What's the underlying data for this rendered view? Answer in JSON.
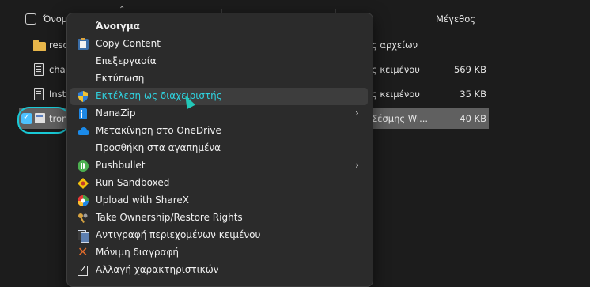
{
  "header": {
    "name_col": "Όνομ",
    "size_col": "Μέγεθος"
  },
  "files": [
    {
      "name": "reso",
      "type_partial": "ς αρχείων",
      "size": "",
      "icon": "folder-icon",
      "selected": false
    },
    {
      "name": "chan",
      "type_partial": "ς κειμένου",
      "size": "569 KB",
      "icon": "text-file-icon",
      "selected": false
    },
    {
      "name": "Instr",
      "type_partial": "ς κειμένου",
      "size": "35 KB",
      "icon": "text-file-icon",
      "selected": false
    },
    {
      "name": "tron",
      "type_partial": "Σέσμης Wi...",
      "size": "40 KB",
      "icon": "batch-file-icon",
      "selected": true
    }
  ],
  "menu": {
    "items": [
      {
        "label": "Άνοιγμα",
        "icon": "",
        "bold": true
      },
      {
        "label": "Copy Content",
        "icon": "clipboard-icon"
      },
      {
        "label": "Επεξεργασία",
        "icon": ""
      },
      {
        "label": "Εκτύπωση",
        "icon": ""
      },
      {
        "label": "Εκτέλεση ως διαχειριστής",
        "icon": "uac-shield-icon",
        "hover": true
      },
      {
        "label": "NanaZip",
        "icon": "nanazip-icon",
        "submenu": true
      },
      {
        "label": "Μετακίνηση στο OneDrive",
        "icon": "onedrive-cloud-icon"
      },
      {
        "label": "Προσθήκη στα αγαπημένα",
        "icon": ""
      },
      {
        "label": "Pushbullet",
        "icon": "pushbullet-icon",
        "submenu": true
      },
      {
        "label": "Run Sandboxed",
        "icon": "sandboxie-icon"
      },
      {
        "label": "Upload with ShareX",
        "icon": "sharex-icon"
      },
      {
        "label": "Take Ownership/Restore Rights",
        "icon": "ownership-keys-icon"
      },
      {
        "label": "Αντιγραφή περιεχομένων κειμένου",
        "icon": "copy-text-icon"
      },
      {
        "label": "Μόνιμη διαγραφή",
        "icon": "delete-x-icon"
      },
      {
        "label": "Αλλαγή χαρακτηριστικών",
        "icon": "attributes-check-icon"
      }
    ],
    "submenu_arrow": "›"
  },
  "colors": {
    "accent": "#19c9d6",
    "hover_text": "#2fd3e0",
    "selected_row": "#606060"
  }
}
